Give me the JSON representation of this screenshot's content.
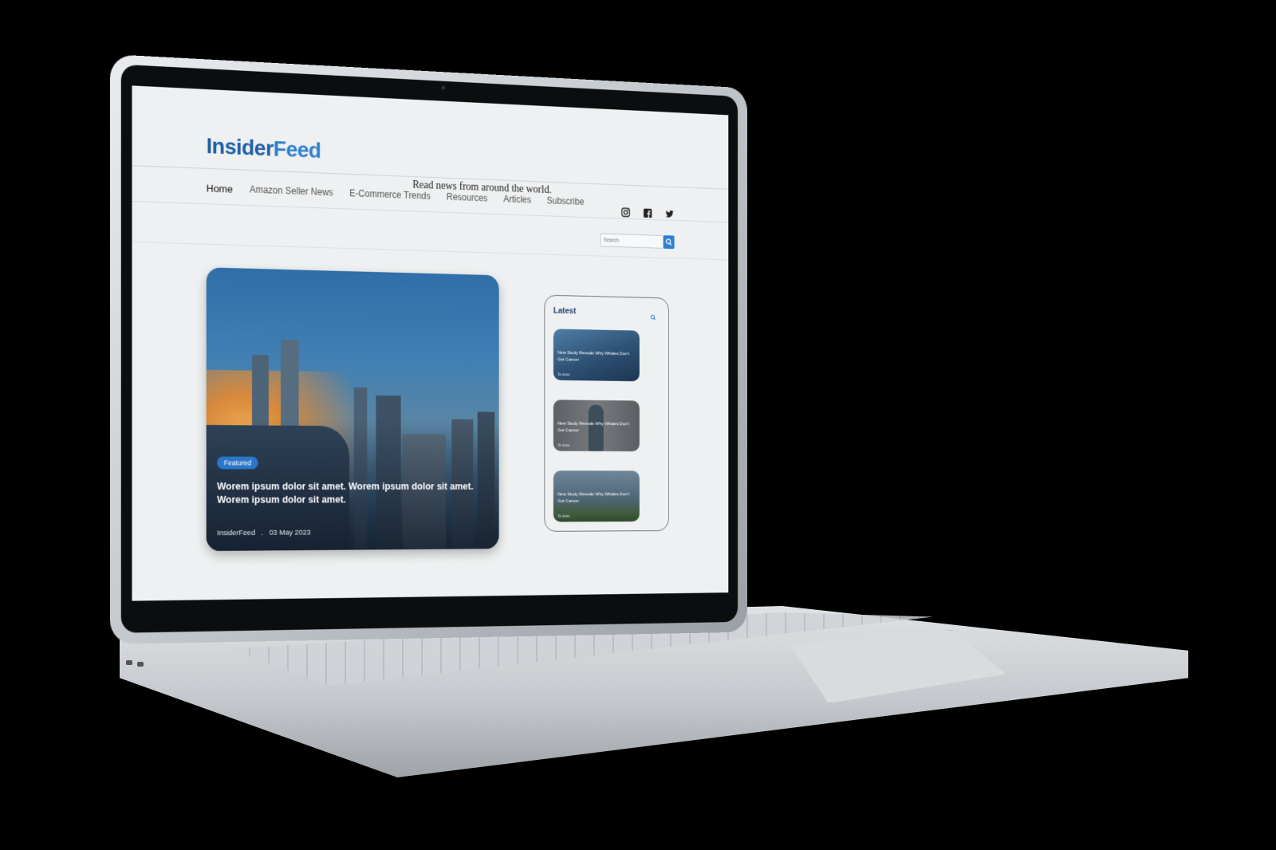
{
  "site": {
    "logo_part1": "Insider",
    "logo_part2": "Feed",
    "tagline": "Read news from around the world."
  },
  "nav": {
    "items": [
      {
        "label": "Home"
      },
      {
        "label": "Amazon Seller News"
      },
      {
        "label": "E-Commerce Trends"
      },
      {
        "label": "Resources"
      },
      {
        "label": "Articles"
      },
      {
        "label": "Subscribe"
      }
    ]
  },
  "social": {
    "icons": [
      "instagram-icon",
      "facebook-icon",
      "twitter-icon"
    ]
  },
  "search": {
    "placeholder": "Search",
    "icon": "search-icon"
  },
  "featured": {
    "badge": "Featured",
    "title": "Worem ipsum dolor sit amet. Worem ipsum dolor sit amet. Worem ipsum dolor sit amet.",
    "author": "InsiderFeed",
    "separator": ".",
    "date": "03 May 2023"
  },
  "latest": {
    "heading": "Latest",
    "cards": [
      {
        "title": "New Study Reveals Why Whales Don't Get Cancer",
        "views": "3k views"
      },
      {
        "title": "New Study Reveals Why Whales Don't Get Cancer",
        "views": "3k views"
      },
      {
        "title": "New Study Reveals Why Whales Don't Get Cancer",
        "views": "3k views"
      }
    ]
  },
  "colors": {
    "brand_dark": "#1f5fa6",
    "brand_light": "#2f7fd1",
    "accent": "#2a76c9"
  }
}
